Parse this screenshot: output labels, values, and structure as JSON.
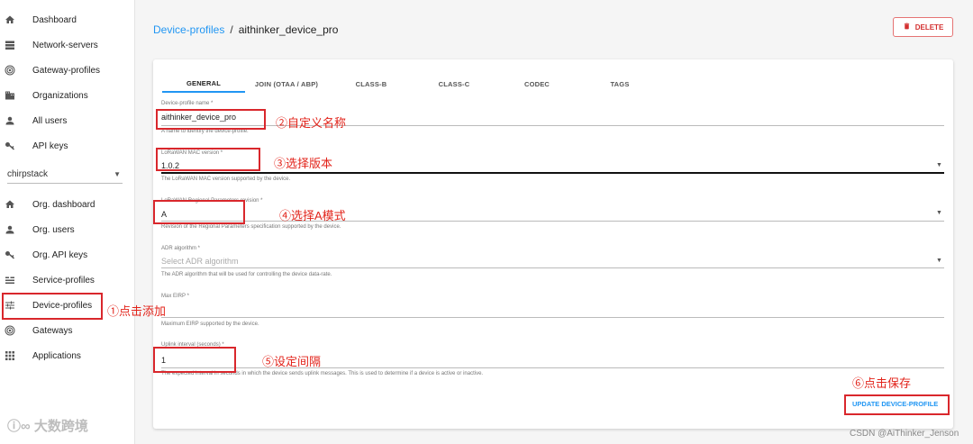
{
  "sidebar": {
    "top_items": [
      {
        "label": "Dashboard",
        "icon": "home-icon"
      },
      {
        "label": "Network-servers",
        "icon": "server-icon"
      },
      {
        "label": "Gateway-profiles",
        "icon": "radio-icon"
      },
      {
        "label": "Organizations",
        "icon": "domain-icon"
      },
      {
        "label": "All users",
        "icon": "person-icon"
      },
      {
        "label": "API keys",
        "icon": "key-icon"
      }
    ],
    "org_select": {
      "value": "chirpstack"
    },
    "org_items": [
      {
        "label": "Org. dashboard",
        "icon": "home-icon"
      },
      {
        "label": "Org. users",
        "icon": "person-icon"
      },
      {
        "label": "Org. API keys",
        "icon": "key-icon"
      },
      {
        "label": "Service-profiles",
        "icon": "list-icon"
      },
      {
        "label": "Device-profiles",
        "icon": "tune-icon"
      },
      {
        "label": "Gateways",
        "icon": "radio-icon"
      },
      {
        "label": "Applications",
        "icon": "apps-icon"
      }
    ]
  },
  "breadcrumb": {
    "parent": "Device-profiles",
    "separator": "/",
    "current": "aithinker_device_pro"
  },
  "header": {
    "delete_label": "DELETE"
  },
  "tabs": [
    "GENERAL",
    "JOIN (OTAA / ABP)",
    "CLASS-B",
    "CLASS-C",
    "CODEC",
    "TAGS"
  ],
  "form": {
    "name": {
      "label": "Device-profile name *",
      "value": "aithinker_device_pro",
      "help": "A name to identify the device-profile."
    },
    "mac_version": {
      "label": "LoRaWAN MAC version *",
      "value": "1.0.2",
      "help": "The LoRaWAN MAC version supported by the device."
    },
    "regional": {
      "label": "LoRaWAN Regional Parameters revision *",
      "value": "A",
      "help": "Revision of the Regional Parameters specification supported by the device."
    },
    "adr": {
      "label": "ADR algorithm *",
      "placeholder": "Select ADR algorithm",
      "help": "The ADR algorithm that will be used for controlling the device data-rate."
    },
    "max_eirp": {
      "label": "Max EIRP *",
      "value": "",
      "help": "Maximum EIRP supported by the device."
    },
    "uplink": {
      "label": "Uplink interval (seconds) *",
      "value": "1",
      "help": "The expected interval in seconds in which the device sends uplink messages. This is used to determine if a device is active or inactive."
    },
    "update_label": "UPDATE DEVICE-PROFILE"
  },
  "annotations": {
    "a1": "①点击添加",
    "a2": "②自定义名称",
    "a3": "③选择版本",
    "a4": "④选择A模式",
    "a5": "⑤设定间隔",
    "a6": "⑥点击保存"
  },
  "watermark": "大数跨境",
  "credit": "CSDN @AiThinker_Jenson",
  "colors": {
    "accent": "#2196f3",
    "danger": "#d32f2f",
    "annotation": "#e2231a"
  }
}
